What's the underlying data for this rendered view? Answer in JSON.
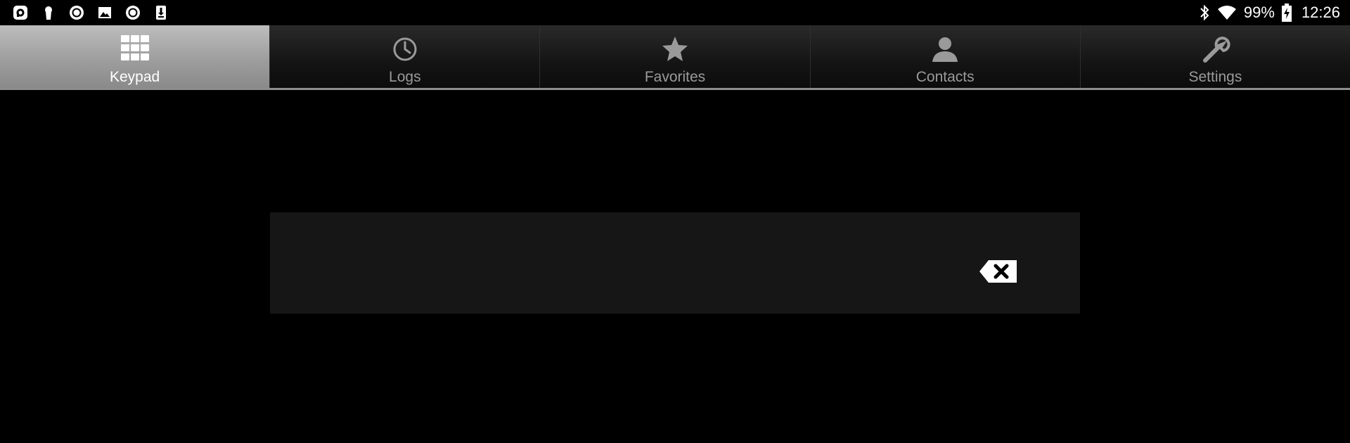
{
  "status_bar": {
    "left_icons": [
      "messenger-icon",
      "keyhole-icon",
      "record-icon",
      "image-icon",
      "record-icon",
      "download-icon"
    ],
    "right_icons": [
      "bluetooth-icon",
      "wifi-icon",
      "battery-charging-icon"
    ],
    "battery_percent": "99%",
    "time": "12:26"
  },
  "tabs": [
    {
      "label": "Keypad",
      "icon": "keypad-grid-icon",
      "active": true
    },
    {
      "label": "Logs",
      "icon": "clock-icon",
      "active": false
    },
    {
      "label": "Favorites",
      "icon": "star-icon",
      "active": false
    },
    {
      "label": "Contacts",
      "icon": "person-icon",
      "active": false
    },
    {
      "label": "Settings",
      "icon": "wrench-icon",
      "active": false
    }
  ],
  "dial_field": {
    "value": "",
    "backspace_icon": "backspace-icon"
  },
  "colors": {
    "background": "#000000",
    "tab_active": "#a8a8a8",
    "tab_inactive_text": "#9a9a9a",
    "field_background": "#161616"
  }
}
